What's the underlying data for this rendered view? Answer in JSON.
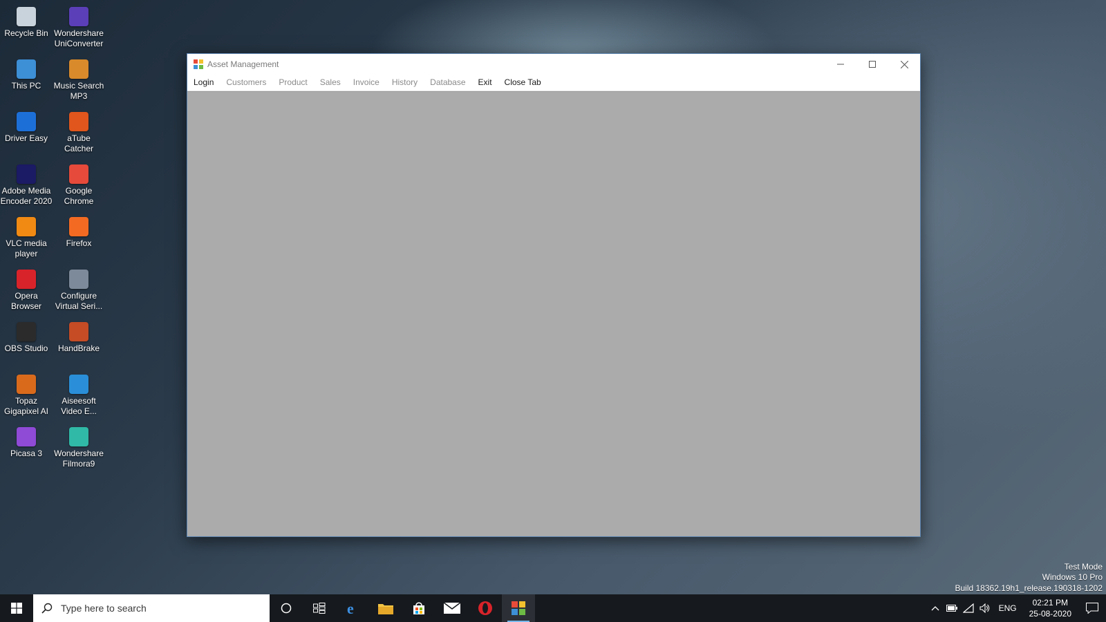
{
  "desktop": {
    "icons": [
      {
        "label": "Recycle Bin",
        "icon": "recycle-bin-icon",
        "color": "#c9d3dc"
      },
      {
        "label": "Wondershare\nUniConverter",
        "icon": "uniconverter-icon",
        "color": "#5b3fb8"
      },
      {
        "label": "This PC",
        "icon": "computer-icon",
        "color": "#3d8fd6"
      },
      {
        "label": "Music Search\nMP3",
        "icon": "music-search-icon",
        "color": "#d98a2b"
      },
      {
        "label": "Driver Easy",
        "icon": "driver-easy-icon",
        "color": "#1d6fd8"
      },
      {
        "label": "aTube\nCatcher",
        "icon": "atube-catcher-icon",
        "color": "#e0561c"
      },
      {
        "label": "Adobe Media\nEncoder 2020",
        "icon": "adobe-media-encoder-icon",
        "color": "#1b1a64"
      },
      {
        "label": "Google\nChrome",
        "icon": "chrome-icon",
        "color": "#e64a3a"
      },
      {
        "label": "VLC media\nplayer",
        "icon": "vlc-icon",
        "color": "#f08a13"
      },
      {
        "label": "Firefox",
        "icon": "firefox-icon",
        "color": "#f36b22"
      },
      {
        "label": "Opera\nBrowser",
        "icon": "opera-icon",
        "color": "#d8232a"
      },
      {
        "label": "Configure\nVirtual Seri...",
        "icon": "virtual-serial-icon",
        "color": "#7d8a99"
      },
      {
        "label": "OBS Studio",
        "icon": "obs-icon",
        "color": "#2b2b2b"
      },
      {
        "label": "HandBrake",
        "icon": "handbrake-icon",
        "color": "#c54c25"
      },
      {
        "label": "Topaz\nGigapixel AI",
        "icon": "topaz-icon",
        "color": "#d96a1c"
      },
      {
        "label": "Aiseesoft\nVideo E...",
        "icon": "aiseesoft-icon",
        "color": "#2a8fd8"
      },
      {
        "label": "Picasa 3",
        "icon": "picasa-icon",
        "color": "#8f4ad6"
      },
      {
        "label": "Wondershare\nFilmora9",
        "icon": "filmora-icon",
        "color": "#2fb9a6"
      }
    ]
  },
  "window": {
    "title": "Asset Management",
    "menu": [
      {
        "label": "Login",
        "active": true
      },
      {
        "label": "Customers",
        "active": false
      },
      {
        "label": "Product",
        "active": false
      },
      {
        "label": "Sales",
        "active": false
      },
      {
        "label": "Invoice",
        "active": false
      },
      {
        "label": "History",
        "active": false
      },
      {
        "label": "Database",
        "active": false
      },
      {
        "label": "Exit",
        "active": true
      },
      {
        "label": "Close Tab",
        "active": true
      }
    ]
  },
  "watermark": {
    "line1": "Test Mode",
    "line2": "Windows 10 Pro",
    "line3": "Build 18362.19h1_release.190318-1202"
  },
  "taskbar": {
    "search_placeholder": "Type here to search",
    "lang": "ENG",
    "time": "02:21 PM",
    "date": "25-08-2020"
  },
  "colors": {
    "accent": "#76b9ed",
    "client_bg": "#ababab"
  }
}
